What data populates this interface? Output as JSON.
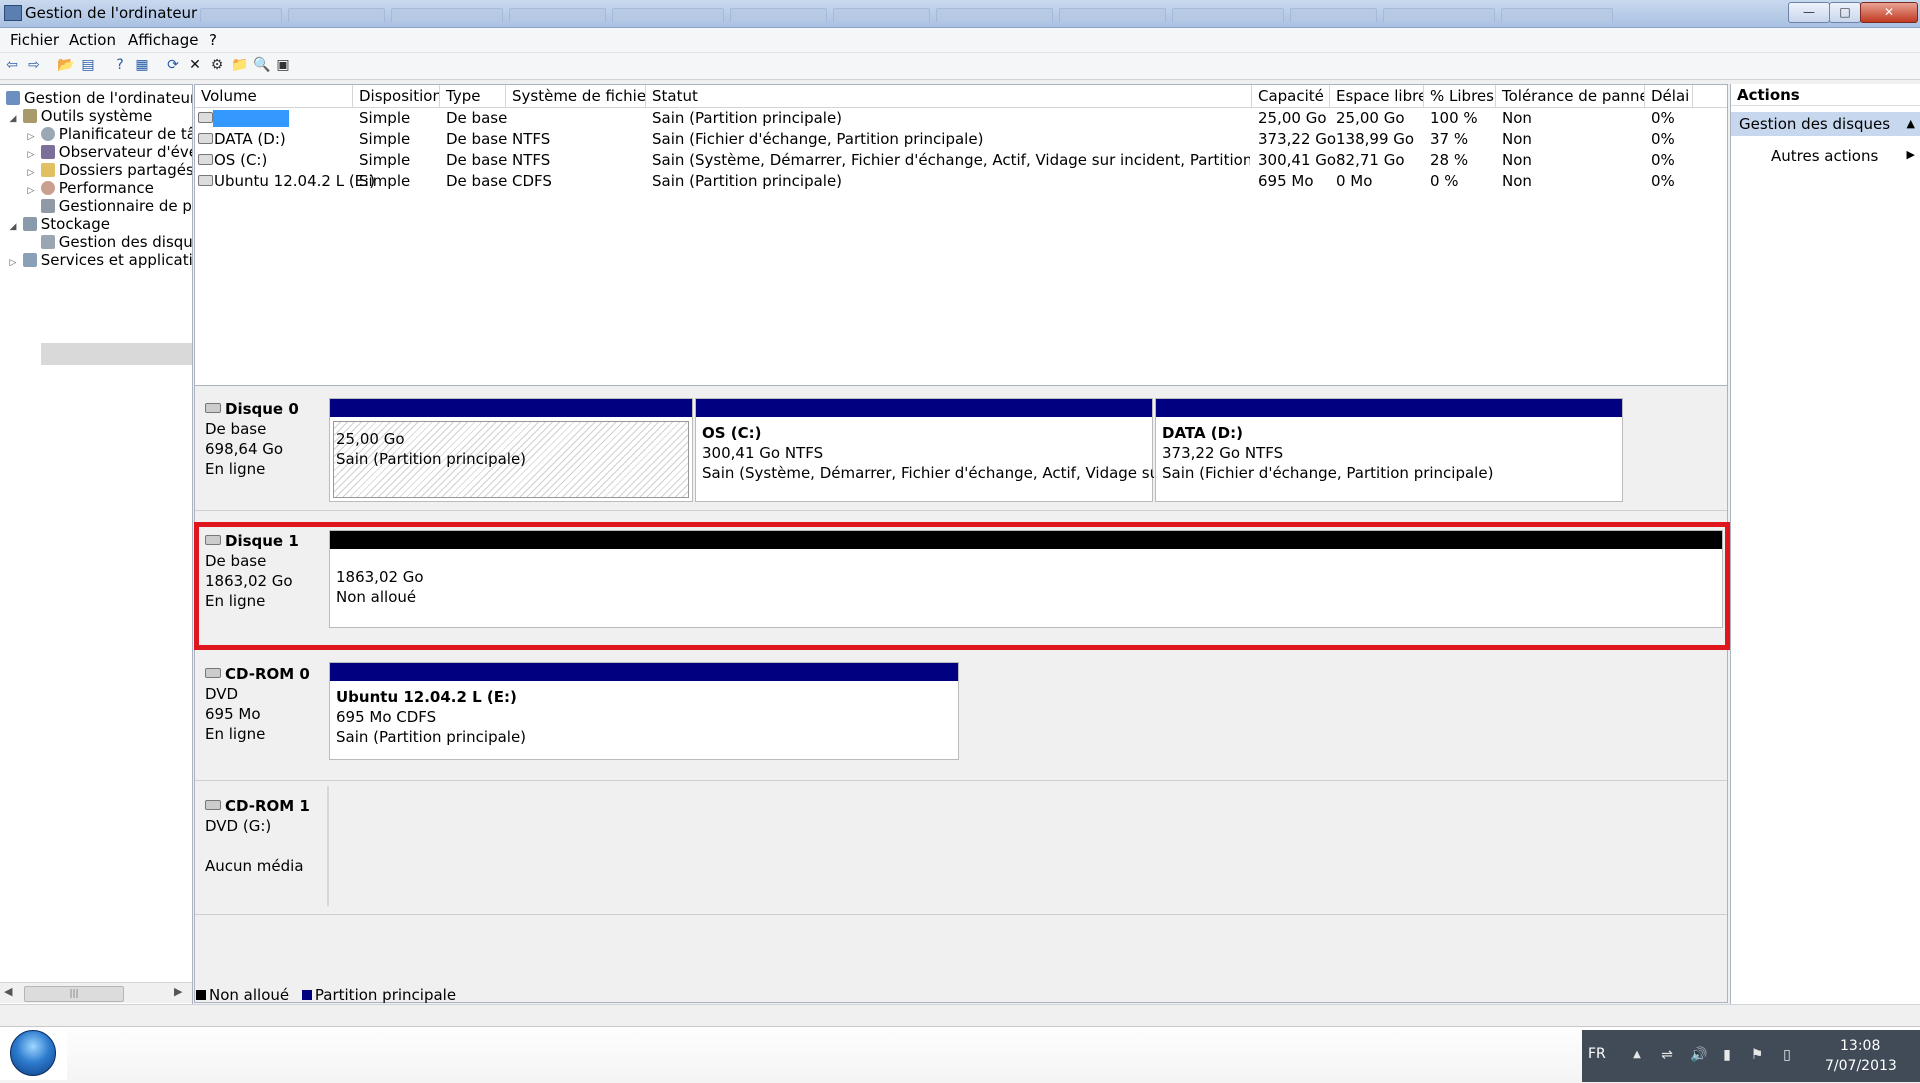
{
  "window": {
    "title": "Gestion de l'ordinateur",
    "minimize_glyph": "—",
    "maximize_glyph": "□",
    "close_glyph": "✕"
  },
  "menu": [
    "Fichier",
    "Action",
    "Affichage",
    "?"
  ],
  "toolbar": {
    "icons": [
      "back-arrow-icon",
      "forward-arrow-icon",
      "up-folder-icon",
      "show-hide-tree-icon",
      "help-icon",
      "properties-icon",
      "refresh-icon",
      "delete-icon",
      "settings-icon",
      "open-icon",
      "search-icon",
      "export-icon"
    ],
    "glyphs": [
      "⇦",
      "⇨",
      "📂",
      "▤",
      "?",
      "▦",
      "⟳",
      "✕",
      "⚙",
      "📁",
      "🔍",
      "▣"
    ]
  },
  "tree": [
    {
      "label": "Gestion de l'ordinateur (l",
      "level": 0,
      "expander": "",
      "icon": "computer-icon"
    },
    {
      "label": "Outils système",
      "level": 1,
      "expander": "◢",
      "icon": "tools-icon"
    },
    {
      "label": "Planificateur de tâc",
      "level": 2,
      "expander": "▷",
      "icon": "clock-icon"
    },
    {
      "label": "Observateur d'évér",
      "level": 2,
      "expander": "▷",
      "icon": "event-viewer-icon"
    },
    {
      "label": "Dossiers partagés",
      "level": 2,
      "expander": "▷",
      "icon": "shared-folder-icon"
    },
    {
      "label": "Performance",
      "level": 2,
      "expander": "▷",
      "icon": "performance-icon"
    },
    {
      "label": "Gestionnaire de pé",
      "level": 2,
      "expander": "",
      "icon": "device-manager-icon"
    },
    {
      "label": "Stockage",
      "level": 1,
      "expander": "◢",
      "icon": "storage-icon"
    },
    {
      "label": "Gestion des disque",
      "level": 2,
      "expander": "",
      "icon": "disk-management-icon"
    },
    {
      "label": "Services et applicatior",
      "level": 1,
      "expander": "▷",
      "icon": "services-icon"
    }
  ],
  "list": {
    "columns": [
      "Volume",
      "Disposition",
      "Type",
      "Système de fichiers",
      "Statut",
      "Capacité",
      "Espace libre",
      "% Libres",
      "Tolérance de pannes",
      "Délai"
    ],
    "rows": [
      {
        "volume": "",
        "disposition": "Simple",
        "type": "De base",
        "fs": "",
        "statut": "Sain (Partition principale)",
        "capacite": "25,00 Go",
        "libre": "25,00 Go",
        "pct": "100 %",
        "tolerance": "Non",
        "delai": "0%"
      },
      {
        "volume": "DATA (D:)",
        "disposition": "Simple",
        "type": "De base",
        "fs": "NTFS",
        "statut": "Sain (Fichier d'échange, Partition principale)",
        "capacite": "373,22 Go",
        "libre": "138,99 Go",
        "pct": "37 %",
        "tolerance": "Non",
        "delai": "0%"
      },
      {
        "volume": "OS (C:)",
        "disposition": "Simple",
        "type": "De base",
        "fs": "NTFS",
        "statut": "Sain (Système, Démarrer, Fichier d'échange, Actif, Vidage sur incident, Partition principale)",
        "capacite": "300,41 Go",
        "libre": "82,71 Go",
        "pct": "28 %",
        "tolerance": "Non",
        "delai": "0%"
      },
      {
        "volume": "Ubuntu 12.04.2 L (E:)",
        "disposition": "Simple",
        "type": "De base",
        "fs": "CDFS",
        "statut": "Sain (Partition principale)",
        "capacite": "695 Mo",
        "libre": "0 Mo",
        "pct": "0 %",
        "tolerance": "Non",
        "delai": "0%"
      }
    ]
  },
  "disks": [
    {
      "name": "Disque 0",
      "kind": "De base",
      "size": "698,64 Go",
      "state": "En ligne",
      "partitions": [
        {
          "title": "",
          "line1": "25,00 Go",
          "line2": "Sain (Partition principale)"
        },
        {
          "title": "OS  (C:)",
          "line1": "300,41 Go NTFS",
          "line2": "Sain (Système, Démarrer, Fichier d'échange, Actif, Vidage sur incide"
        },
        {
          "title": "DATA  (D:)",
          "line1": "373,22 Go NTFS",
          "line2": "Sain (Fichier d'échange, Partition principale)"
        }
      ]
    },
    {
      "name": "Disque 1",
      "kind": "De base",
      "size": "1863,02 Go",
      "state": "En ligne",
      "partitions": [
        {
          "title": "",
          "line1": "1863,02 Go",
          "line2": "Non alloué"
        }
      ]
    },
    {
      "name": "CD-ROM 0",
      "kind": "DVD",
      "size": "695 Mo",
      "state": "En ligne",
      "partitions": [
        {
          "title": "Ubuntu 12.04.2 L  (E:)",
          "line1": "695 Mo CDFS",
          "line2": "Sain (Partition principale)"
        }
      ]
    },
    {
      "name": "CD-ROM 1",
      "kind": "DVD (G:)",
      "size": "",
      "state": "Aucun média",
      "partitions": []
    }
  ],
  "legend": {
    "unallocated": "Non alloué",
    "primary": "Partition principale"
  },
  "colors": {
    "primary_partition": "#000080",
    "unallocated": "#000000",
    "highlight": "#e0161e",
    "selected_volume": "#3399ff"
  },
  "actions": {
    "header": "Actions",
    "selected": "Gestion des disques",
    "selected_glyph": "▲",
    "more": "Autres actions",
    "more_glyph": "▶"
  },
  "tree_scroll": {
    "left": "◀",
    "right": "▶",
    "grip": "|||"
  },
  "taskbar": {
    "lang": "FR",
    "time": "13:08",
    "date": "7/07/2013",
    "tray_icons": [
      "show-hidden-icons-icon",
      "network-icon",
      "volume-icon",
      "signal-icon",
      "action-center-flag-icon",
      "power-icon"
    ],
    "tray_glyphs": [
      "▲",
      "⇌",
      "🔊",
      "▮",
      "⚑",
      "▯"
    ]
  }
}
